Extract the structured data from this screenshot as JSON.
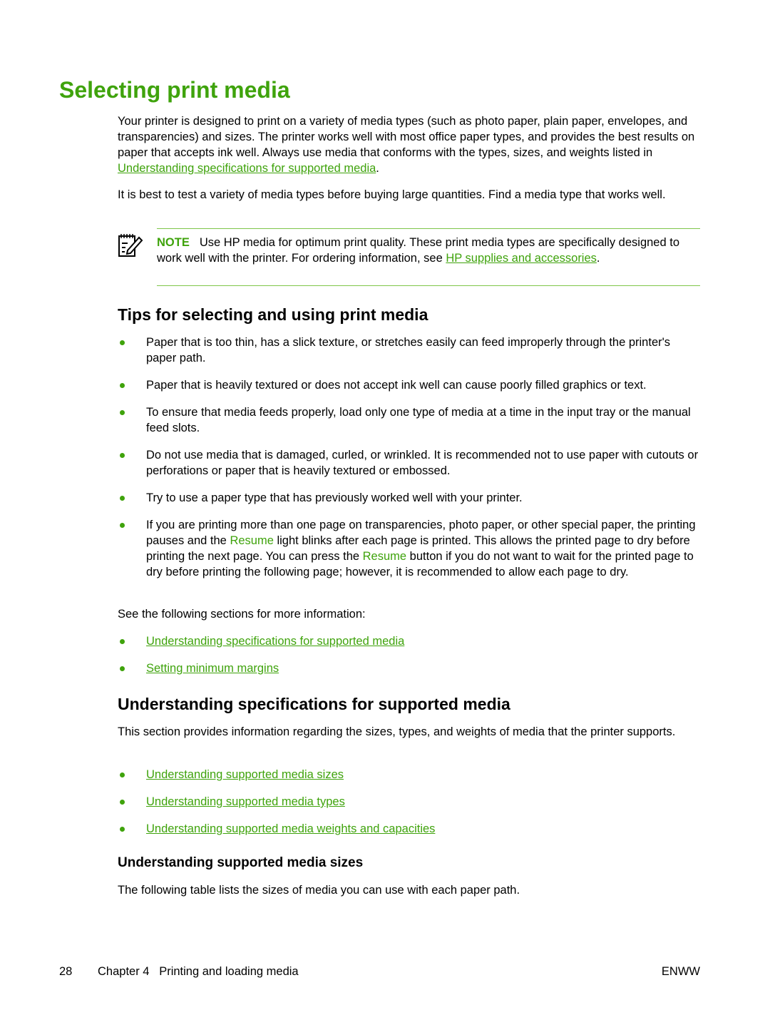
{
  "title": "Selecting print media",
  "intro": {
    "p1_text": "Your printer is designed to print on a variety of media types (such as photo paper, plain paper, envelopes, and transparencies) and sizes. The printer works well with most office paper types, and provides the best results on paper that accepts ink well. Always use media that conforms with the types, sizes, and weights listed in ",
    "p1_link": "Understanding specifications for supported media",
    "p1_end": ".",
    "p2": "It is best to test a variety of media types before buying large quantities. Find a media type that works well."
  },
  "note": {
    "icon": "note-pencil-icon",
    "label": "NOTE",
    "text": "Use HP media for optimum print quality. These print media types are specifically designed to work well with the printer. For ordering information, see ",
    "link": "HP supplies and accessories",
    "end": "."
  },
  "tips": {
    "heading": "Tips for selecting and using print media",
    "items": [
      "Paper that is too thin, has a slick texture, or stretches easily can feed improperly through the printer's paper path.",
      "Paper that is heavily textured or does not accept ink well can cause poorly filled graphics or text.",
      "To ensure that media feeds properly, load only one type of media at a time in the input tray or the manual feed slots.",
      "Do not use media that is damaged, curled, or wrinkled. It is recommended not to use paper with cutouts or perforations or paper that is heavily textured or embossed.",
      "Try to use a paper type that has previously worked well with your printer."
    ],
    "resume_item": {
      "part1": "If you are printing more than one page on transparencies, photo paper, or other special paper, the printing pauses and the ",
      "resume1": "Resume",
      "part2": " light blinks after each page is printed. This allows the printed page to dry before printing the next page. You can press the ",
      "resume2": "Resume",
      "part3": " button if you do not want to wait for the printed page to dry before printing the following page; however, it is recommended to allow each page to dry."
    },
    "see_also": "See the following sections for more information:",
    "links": [
      "Understanding specifications for supported media",
      "Setting minimum margins"
    ]
  },
  "specs": {
    "heading": "Understanding specifications for supported media",
    "intro": "This section provides information regarding the sizes, types, and weights of media that the printer supports.",
    "links": [
      "Understanding supported media sizes",
      "Understanding supported media types",
      "Understanding supported media weights and capacities"
    ]
  },
  "sizes": {
    "heading": "Understanding supported media sizes",
    "intro": "The following table lists the sizes of media you can use with each paper path."
  },
  "footer": {
    "page_number": "28",
    "chapter": "Chapter 4   Printing and loading media",
    "right": "ENWW"
  },
  "colors": {
    "accent": "#3fa30c",
    "rule": "#7fc64a"
  }
}
